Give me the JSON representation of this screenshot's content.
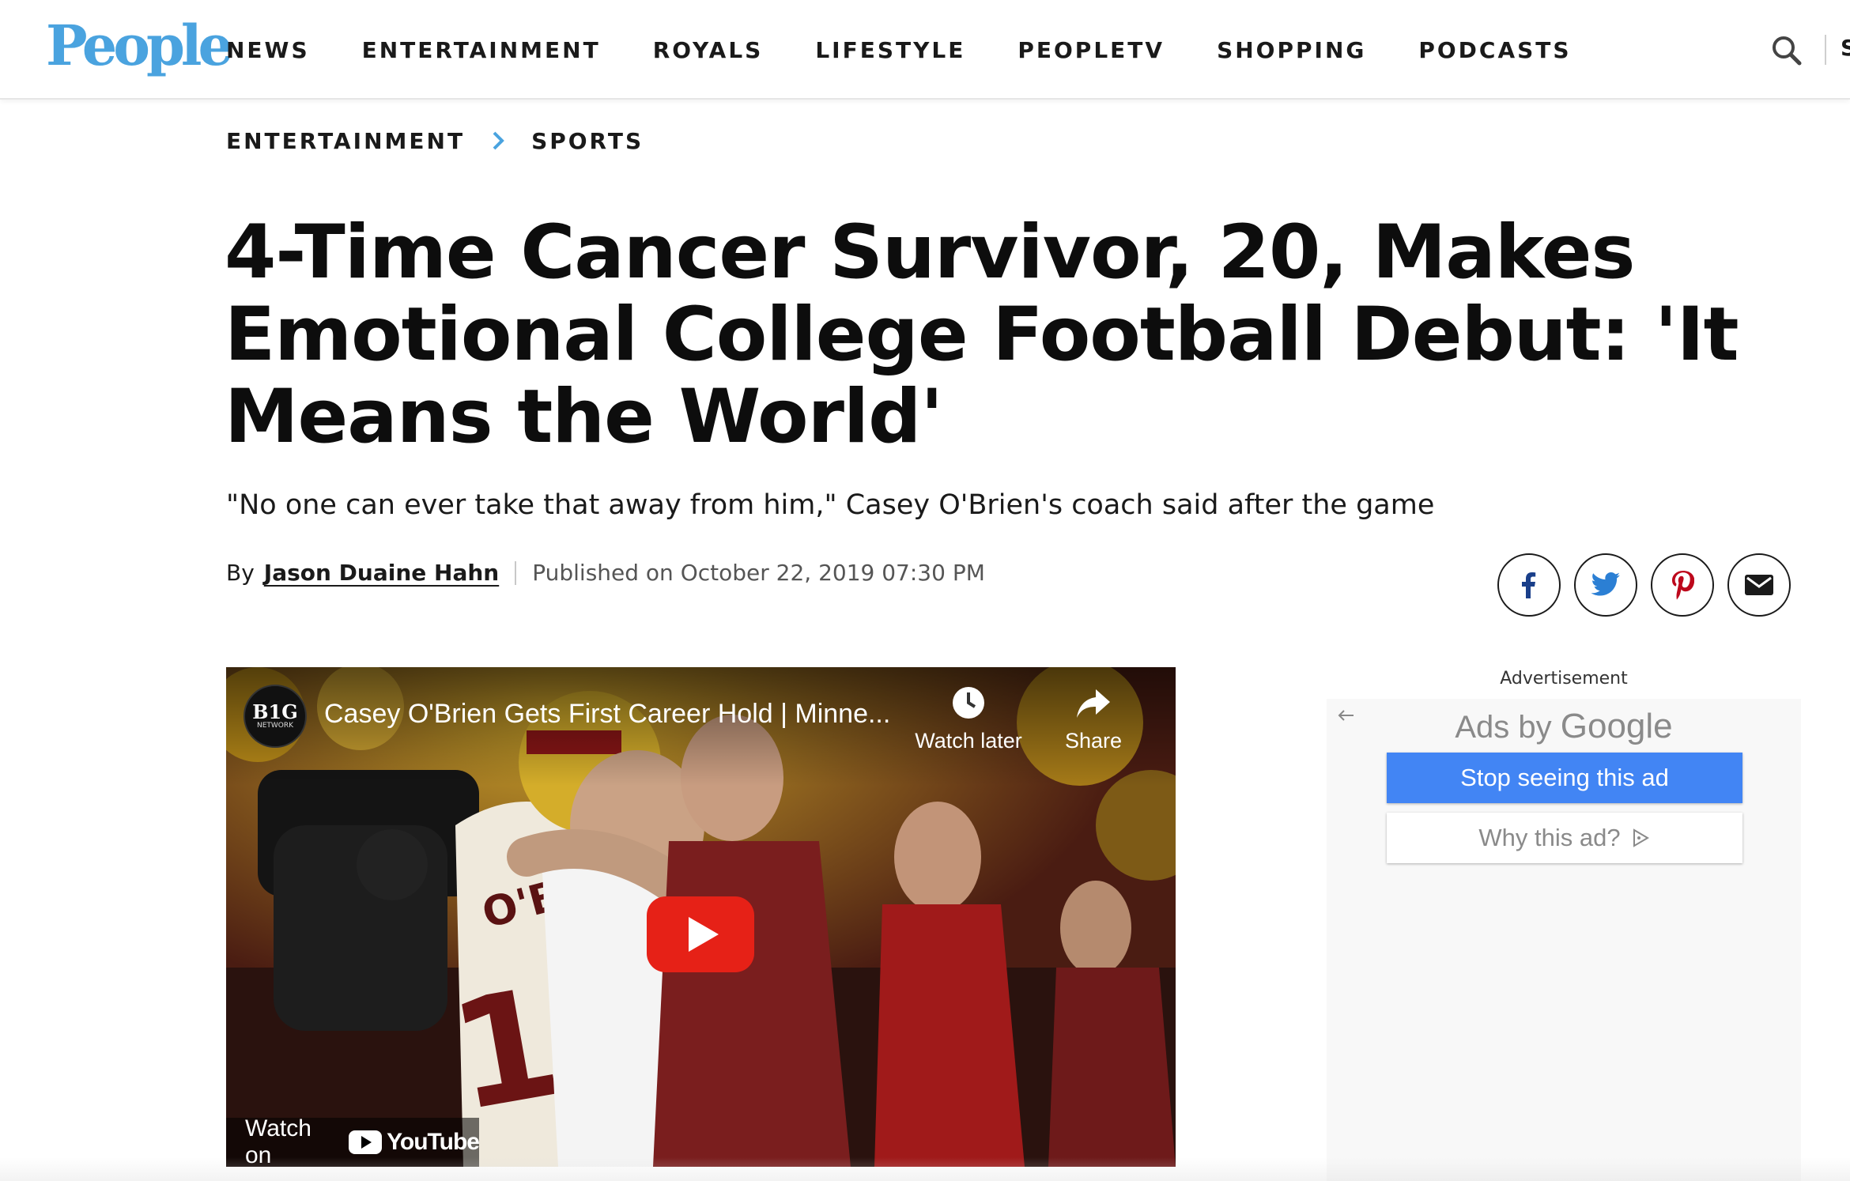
{
  "header": {
    "logo": "People",
    "nav": [
      "NEWS",
      "ENTERTAINMENT",
      "ROYALS",
      "LIFESTYLE",
      "PEOPLETV",
      "SHOPPING",
      "PODCASTS"
    ],
    "clipped_item": "S"
  },
  "breadcrumb": [
    "ENTERTAINMENT",
    "SPORTS"
  ],
  "article": {
    "headline": "4-Time Cancer Survivor, 20, Makes Emotional College Football Debut: 'It Means the World'",
    "subhead": "\"No one can ever take that away from him,\" Casey O'Brien's coach said after the game",
    "by_label": "By",
    "author": "Jason Duaine Hahn",
    "published": "Published on October 22, 2019 07:30 PM"
  },
  "share_icons": [
    "facebook-icon",
    "twitter-icon",
    "pinterest-icon",
    "email-icon"
  ],
  "video": {
    "channel_badge": "B1G",
    "channel_sub": "NETWORK",
    "title": "Casey O'Brien Gets First Career Hold | Minne...",
    "watch_later": "Watch later",
    "share": "Share",
    "watch_on": "Watch on",
    "youtube": "YouTube"
  },
  "ad": {
    "label": "Advertisement",
    "ads_by": "Ads by",
    "google": "Google",
    "stop_seeing": "Stop seeing this ad",
    "why": "Why this ad?"
  },
  "colors": {
    "brand_blue": "#4aa3df",
    "ad_button_blue": "#4285f4",
    "youtube_red": "#e62117"
  }
}
